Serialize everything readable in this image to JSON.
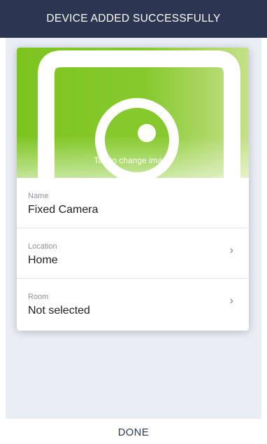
{
  "header": {
    "title": "DEVICE ADDED SUCCESSFULLY"
  },
  "device_image": {
    "caption": "Tap to change image",
    "icon": "camera-icon",
    "colors": {
      "primary": "#7cc51f",
      "light": "#c5e189"
    }
  },
  "fields": {
    "name": {
      "label": "Name",
      "value": "Fixed Camera"
    },
    "location": {
      "label": "Location",
      "value": "Home",
      "chevron": "›"
    },
    "room": {
      "label": "Room",
      "value": "Not selected",
      "chevron": "›"
    }
  },
  "footer": {
    "done_label": "DONE"
  },
  "colors": {
    "header_bg": "#2c3552",
    "panel_bg": "#e9eef5"
  }
}
